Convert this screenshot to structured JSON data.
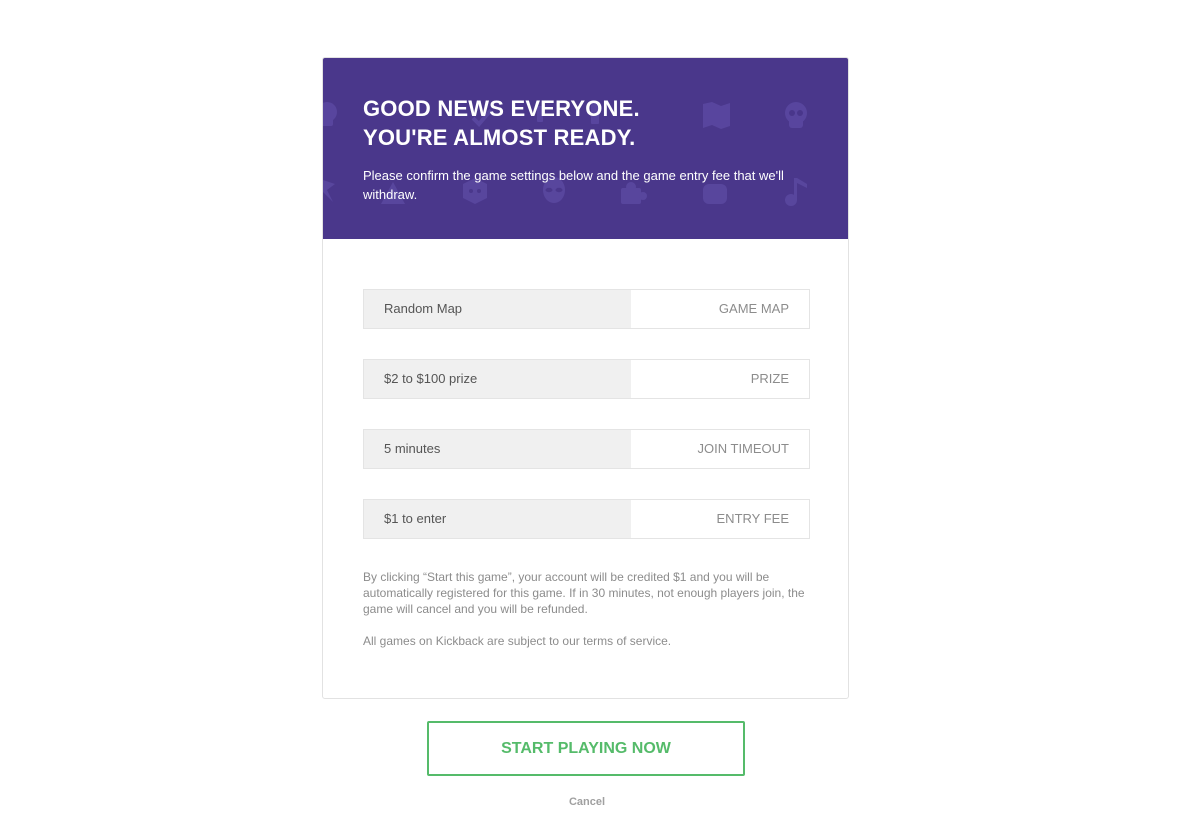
{
  "dialog": {
    "title_line1": "GOOD NEWS EVERYONE.",
    "title_line2": "YOU'RE ALMOST READY.",
    "subtitle": "Please confirm the game settings below and the game entry fee that we'll withdraw.",
    "header_bg": "#4a378b"
  },
  "settings": [
    {
      "value": "Random Map",
      "label": "GAME MAP"
    },
    {
      "value": "$2 to $100 prize",
      "label": "PRIZE"
    },
    {
      "value": "5 minutes",
      "label": "JOIN TIMEOUT"
    },
    {
      "value": "$1 to enter",
      "label": "ENTRY FEE"
    }
  ],
  "disclaimer": "By clicking “Start this game”, your account will be credited $1 and you will be automatically registered for this game. If in 30 minutes, not enough players join, the game will cancel and you will be refunded.",
  "terms": "All games on Kickback are subject to our terms of service.",
  "actions": {
    "start_label": "START PLAYING NOW",
    "cancel_label": "Cancel",
    "accent_color": "#55bb6a"
  },
  "icons": [
    "skull-icon",
    "map-icon",
    "alien-icon",
    "puzzle-icon",
    "fist-icon",
    "music-note-icon",
    "dice-icon"
  ]
}
